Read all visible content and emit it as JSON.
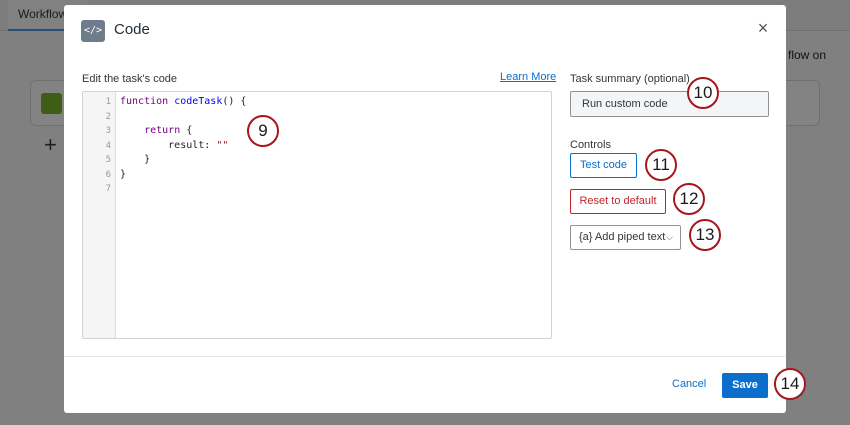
{
  "background": {
    "tab_label": "Workflow o",
    "right_text": "flow on"
  },
  "modal": {
    "icon_glyph": "</>",
    "title": "Code",
    "close_glyph": "×"
  },
  "editor": {
    "label": "Edit the task's code",
    "learn_more": "Learn More",
    "line_numbers": [
      "1",
      "2",
      "3",
      "4",
      "5",
      "6",
      "7"
    ]
  },
  "summary": {
    "label": "Task summary (optional)",
    "value": "Run custom code"
  },
  "controls": {
    "label": "Controls",
    "test_button": "Test code",
    "reset_button": "Reset to default",
    "piped_button": "{a} Add piped text",
    "piped_chevron": "⌵"
  },
  "footer": {
    "cancel": "Cancel",
    "save": "Save"
  },
  "callouts": {
    "c9": "9",
    "c10": "10",
    "c11": "11",
    "c12": "12",
    "c13": "13",
    "c14": "14"
  },
  "code": {
    "l1_kw": "function ",
    "l1_fn": "codeTask",
    "l1_rest": "() {",
    "l3_indent": "    ",
    "l3_kw": "return",
    "l3_rest": " {",
    "l4_text": "        result: ",
    "l4_str": "\"\"",
    "l5_text": "    }",
    "l6_text": "}"
  },
  "colors": {
    "accent": "#0b6ecb",
    "danger": "#c0242b",
    "callout_ring": "#a5171d"
  }
}
